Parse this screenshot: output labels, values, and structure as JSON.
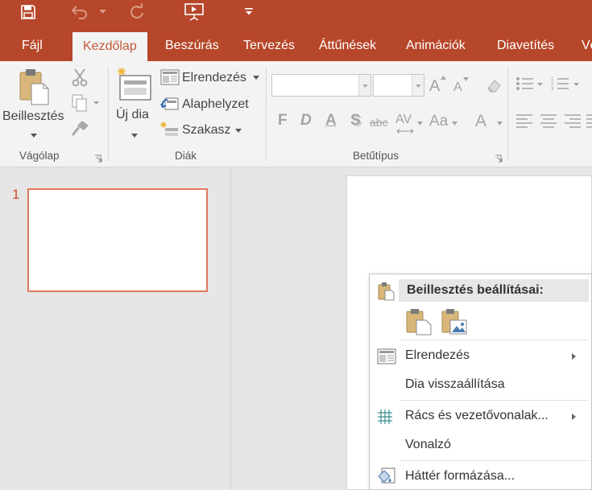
{
  "quick_access": {
    "icons": [
      "save-icon",
      "undo-icon",
      "undo-dropdown-icon",
      "redo-icon",
      "present-from-beginning-icon",
      "customize-qat-icon"
    ]
  },
  "tabs": [
    {
      "label": "Fájl"
    },
    {
      "label": "Kezdőlap",
      "active": true
    },
    {
      "label": "Beszúrás"
    },
    {
      "label": "Tervezés"
    },
    {
      "label": "Áttűnések"
    },
    {
      "label": "Animációk"
    },
    {
      "label": "Diavetítés"
    },
    {
      "label": "Vé"
    }
  ],
  "ribbon": {
    "clipboard": {
      "paste": "Beillesztés",
      "group_label": "Vágólap"
    },
    "slides": {
      "new_slide": "Új dia",
      "layout": "Elrendezés",
      "reset": "Alaphelyzet",
      "section": "Szakasz",
      "group_label": "Diák"
    },
    "font": {
      "font_name": "",
      "font_size": "",
      "bold": "F",
      "italic": "D",
      "underline": "A",
      "shadow": "S",
      "strikethrough": "abc",
      "spacing": "AV",
      "change_case": "Aa",
      "font_color": "A",
      "grow": "A",
      "shrink": "A",
      "group_label": "Betűtípus"
    }
  },
  "slides_pane": {
    "slide_number": "1"
  },
  "context_menu": {
    "paste_header": "Beillesztés beállításai:",
    "items": [
      {
        "label": "Elrendezés",
        "submenu": true
      },
      {
        "label": "Dia visszaállítása",
        "submenu": false
      },
      {
        "label": "Rács és vezetővonalak...",
        "submenu": true
      },
      {
        "label": "Vonalzó",
        "submenu": false
      },
      {
        "label": "Háttér formázása...",
        "submenu": false
      }
    ]
  },
  "colors": {
    "accent": "#b7472a",
    "ribbon_bg": "#f3f3f3",
    "active_tab_text": "#c55a3a",
    "thumb_border": "#e07a5f",
    "slide_number": "#d24726"
  }
}
